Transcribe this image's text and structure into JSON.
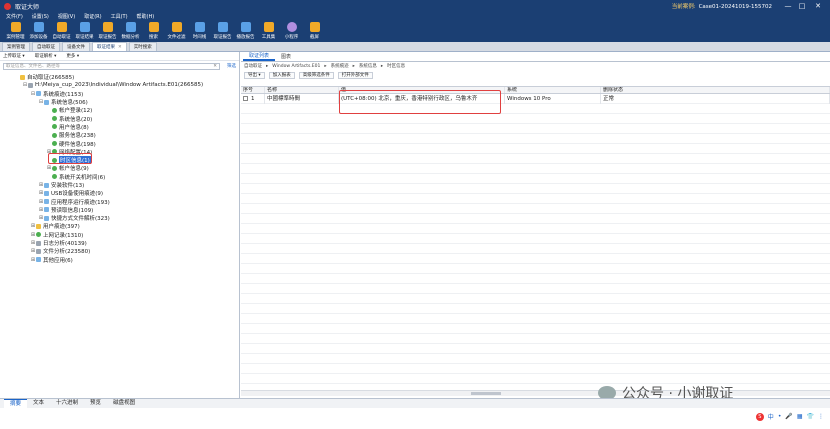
{
  "window": {
    "title": "取证大师",
    "case_label": "当前案例:",
    "case_value": "Case01-20241019-155702",
    "min_glyph": "—",
    "max_glyph": "□",
    "close_glyph": "✕"
  },
  "menu": [
    "文件(F)",
    "设置(S)",
    "视图(V)",
    "取证(R)",
    "工具(T)",
    "帮助(H)"
  ],
  "toolbar": [
    {
      "label": "案例管理",
      "icon": "case-icon"
    },
    {
      "label": "添加设备",
      "icon": "add-device-icon"
    },
    {
      "label": "自动取证",
      "icon": "auto-forensic-icon"
    },
    {
      "label": "取证结果",
      "icon": "result-icon"
    },
    {
      "label": "取证报告",
      "icon": "report-icon"
    },
    {
      "label": "数据分析",
      "icon": "analysis-icon"
    },
    {
      "label": "搜索",
      "icon": "search-icon"
    },
    {
      "label": "文件过滤",
      "icon": "filter-icon"
    },
    {
      "label": "时间线",
      "icon": "timeline-icon"
    },
    {
      "label": "取证报告",
      "icon": "report2-icon"
    },
    {
      "label": "播放报告",
      "icon": "play-icon"
    },
    {
      "label": "工具集",
      "icon": "tools-icon"
    },
    {
      "label": "小程序",
      "icon": "miniapp-icon"
    },
    {
      "label": "截屏",
      "icon": "screenshot-icon"
    }
  ],
  "tabs": [
    {
      "label": "案例管理"
    },
    {
      "label": "自动取证"
    },
    {
      "label": "设备文件"
    },
    {
      "label": "取证结果",
      "active": true
    },
    {
      "label": "实时搜索"
    }
  ],
  "left": {
    "sub": [
      "上传取证 ▾",
      "取证解析 ▾",
      "更多 ▾"
    ],
    "search_placeholder": "取证信息、文件名、路径等",
    "search_clear": "✕",
    "search_go": "筛选",
    "tree": [
      {
        "level": 0,
        "exp": "",
        "icon": "y",
        "label": "自动取证(266585)"
      },
      {
        "level": 1,
        "exp": "⊟",
        "icon": "s",
        "label": "H:\\Meiya_cup_2023\\Individual\\Window Artifacts.E01(266585)"
      },
      {
        "level": 2,
        "exp": "⊟",
        "icon": "b",
        "label": "系统痕迹(1153)"
      },
      {
        "level": 3,
        "exp": "⊟",
        "icon": "b",
        "label": "系统信息(506)"
      },
      {
        "level": 4,
        "exp": "",
        "icon": "g",
        "label": "帐户登录(12)"
      },
      {
        "level": 4,
        "exp": "",
        "icon": "g",
        "label": "系统信息(20)"
      },
      {
        "level": 4,
        "exp": "",
        "icon": "g",
        "label": "用户信息(8)"
      },
      {
        "level": 4,
        "exp": "",
        "icon": "g",
        "label": "服务信息(238)"
      },
      {
        "level": 4,
        "exp": "",
        "icon": "g",
        "label": "硬件信息(198)"
      },
      {
        "level": 4,
        "exp": "⊞",
        "icon": "g",
        "label": "网络配置(14)"
      },
      {
        "level": 4,
        "exp": "",
        "icon": "g",
        "label": "时区信息(1)",
        "selected": true
      },
      {
        "level": 4,
        "exp": "⊞",
        "icon": "g",
        "label": "帐户信息(9)"
      },
      {
        "level": 4,
        "exp": "",
        "icon": "g",
        "label": "系统开关机时间(6)"
      },
      {
        "level": 3,
        "exp": "⊞",
        "icon": "b",
        "label": "安装软件(13)"
      },
      {
        "level": 3,
        "exp": "⊞",
        "icon": "b",
        "label": "USB设备使用痕迹(9)"
      },
      {
        "level": 3,
        "exp": "⊞",
        "icon": "b",
        "label": "应用程序运行痕迹(193)"
      },
      {
        "level": 3,
        "exp": "⊞",
        "icon": "b",
        "label": "预读取信息(109)"
      },
      {
        "level": 3,
        "exp": "⊞",
        "icon": "b",
        "label": "快捷方式文件解析(323)"
      },
      {
        "level": 2,
        "exp": "⊞",
        "icon": "y",
        "label": "用户痕迹(397)"
      },
      {
        "level": 2,
        "exp": "⊞",
        "icon": "g",
        "label": "上网记录(1310)"
      },
      {
        "level": 2,
        "exp": "⊞",
        "icon": "s",
        "label": "日志分析(40139)"
      },
      {
        "level": 2,
        "exp": "⊞",
        "icon": "s",
        "label": "文件分析(223580)"
      },
      {
        "level": 2,
        "exp": "⊞",
        "icon": "b",
        "label": "其他应用(6)"
      }
    ]
  },
  "right": {
    "tabs": [
      "取证列表",
      "图表"
    ],
    "crumbs": [
      "自动取证",
      "▸",
      "Window Artifacts.E01",
      "▸",
      "系统痕迹",
      "▸",
      "系统信息",
      "▸",
      "时区信息"
    ],
    "tools": [
      "导出 ▾",
      "加入报表",
      "高级筛选条件",
      "打开外部文件"
    ],
    "columns": [
      "序号",
      "名称",
      "值",
      "系统",
      "删除状态"
    ],
    "rows": [
      {
        "num": "1",
        "name": "中國標準時間",
        "value": "(UTC+08:00) 北京，重庆，香港特别行政区，乌鲁木齐",
        "system": "Windows 10 Pro",
        "status": "正常"
      }
    ]
  },
  "bottom_tabs": [
    "摘要",
    "文本",
    "十六进制",
    "预览",
    "磁盘视图"
  ],
  "watermark": "公众号 · 小谢取证",
  "ime": [
    "S",
    "中",
    "•",
    "🎤",
    "▦",
    "👕",
    "⋮"
  ]
}
